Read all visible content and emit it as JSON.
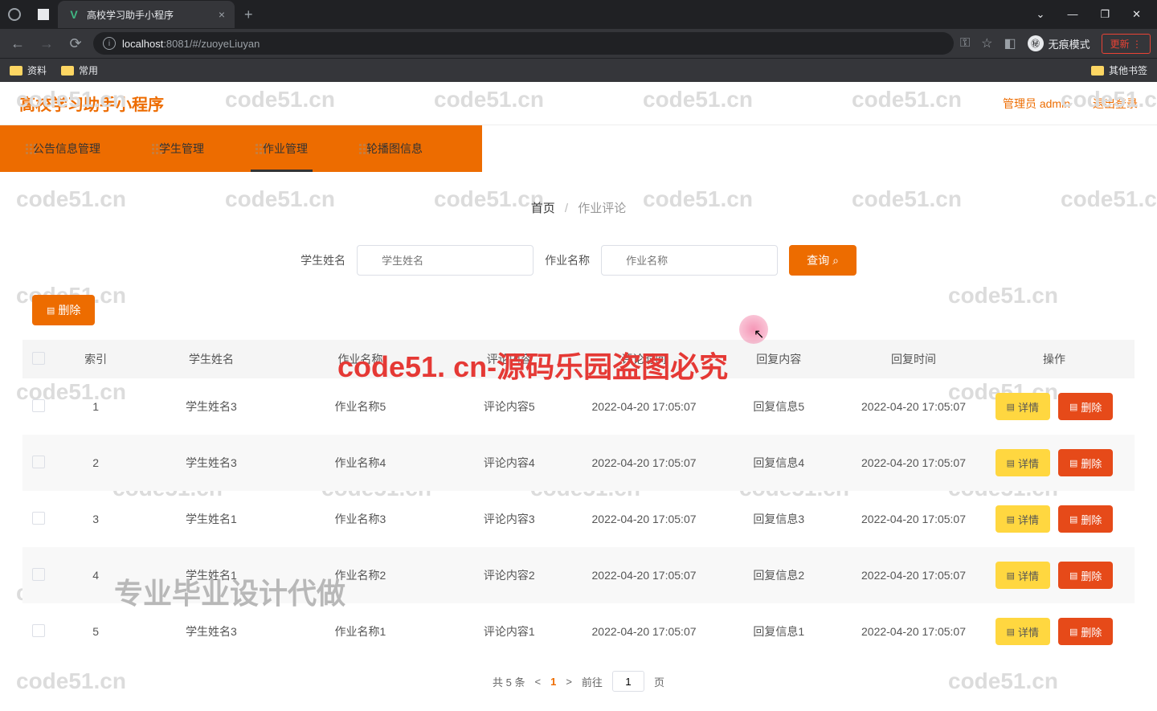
{
  "browser": {
    "tab_title": "高校学习助手小程序",
    "url_host": "localhost",
    "url_port": ":8081",
    "url_path": "/#/zuoyeLiuyan",
    "incognito_label": "无痕模式",
    "update_label": "更新",
    "bookmarks": [
      "资料",
      "常用"
    ],
    "other_bookmarks": "其他书签"
  },
  "header": {
    "app_title": "高校学习助手小程序",
    "admin_label": "管理员 admin",
    "logout_label": "退出登录"
  },
  "nav": {
    "items": [
      "公告信息管理",
      "学生管理",
      "作业管理",
      "轮播图信息"
    ]
  },
  "breadcrumb": {
    "home": "首页",
    "current": "作业评论"
  },
  "search": {
    "label_student": "学生姓名",
    "placeholder_student": "学生姓名",
    "label_homework": "作业名称",
    "placeholder_homework": "作业名称",
    "query_btn": "查询"
  },
  "actions": {
    "delete_btn": "删除",
    "detail_btn": "详情"
  },
  "table": {
    "headers": [
      "索引",
      "学生姓名",
      "作业名称",
      "评论内容",
      "评论时间",
      "回复内容",
      "回复时间",
      "操作"
    ],
    "rows": [
      {
        "idx": "1",
        "student": "学生姓名3",
        "hw": "作业名称5",
        "comment": "评论内容5",
        "ctime": "2022-04-20 17:05:07",
        "reply": "回复信息5",
        "rtime": "2022-04-20 17:05:07"
      },
      {
        "idx": "2",
        "student": "学生姓名3",
        "hw": "作业名称4",
        "comment": "评论内容4",
        "ctime": "2022-04-20 17:05:07",
        "reply": "回复信息4",
        "rtime": "2022-04-20 17:05:07"
      },
      {
        "idx": "3",
        "student": "学生姓名1",
        "hw": "作业名称3",
        "comment": "评论内容3",
        "ctime": "2022-04-20 17:05:07",
        "reply": "回复信息3",
        "rtime": "2022-04-20 17:05:07"
      },
      {
        "idx": "4",
        "student": "学生姓名1",
        "hw": "作业名称2",
        "comment": "评论内容2",
        "ctime": "2022-04-20 17:05:07",
        "reply": "回复信息2",
        "rtime": "2022-04-20 17:05:07"
      },
      {
        "idx": "5",
        "student": "学生姓名3",
        "hw": "作业名称1",
        "comment": "评论内容1",
        "ctime": "2022-04-20 17:05:07",
        "reply": "回复信息1",
        "rtime": "2022-04-20 17:05:07"
      }
    ]
  },
  "pagination": {
    "total": "共 5 条",
    "page": "1",
    "goto": "前往",
    "page_suffix": "页"
  },
  "watermarks": {
    "light": "code51.cn",
    "red": "code51. cn-源码乐园盗图必究",
    "gray": "专业毕业设计代做"
  }
}
